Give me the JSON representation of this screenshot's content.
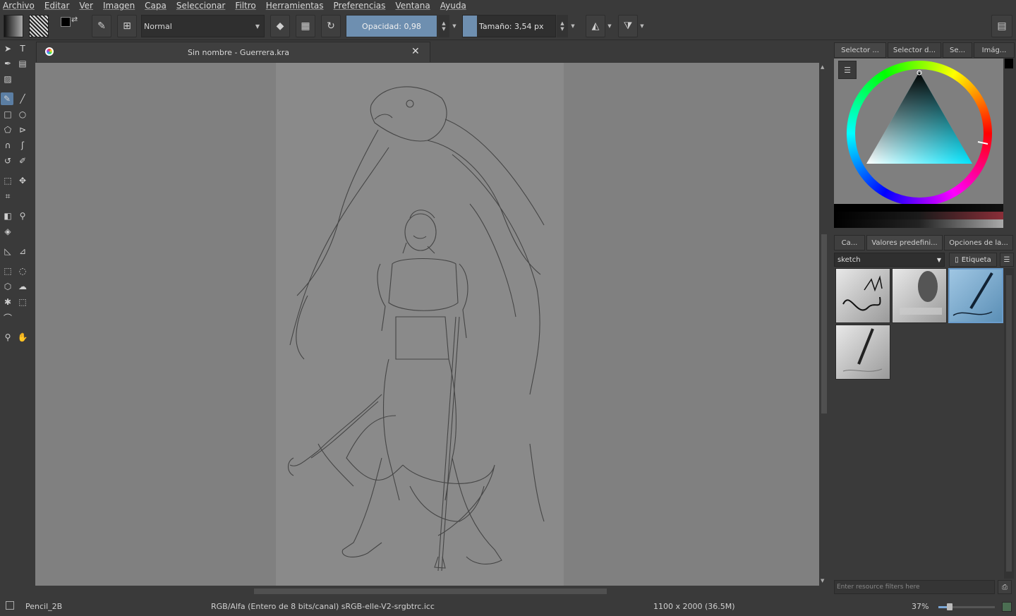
{
  "menu": [
    "Archivo",
    "Editar",
    "Ver",
    "Imagen",
    "Capa",
    "Seleccionar",
    "Filtro",
    "Herramientas",
    "Preferencias",
    "Ventana",
    "Ayuda"
  ],
  "toolbar": {
    "blend_mode": "Normal",
    "opacity_label": "Opacidad:  0,98",
    "opacity_value": 0.98,
    "size_label": "Tamaño:  3,54 px"
  },
  "document": {
    "tab_title": "Sin nombre - Guerrera.kra"
  },
  "docker": {
    "top_tabs": [
      "Selector ...",
      "Selector d...",
      "Se...",
      "Imág..."
    ],
    "preset_tabs": [
      "Ca...",
      "Valores predefini...",
      "Opciones de la..."
    ],
    "preset_filter": "sketch",
    "tag_label": "Etiqueta",
    "resource_filter_placeholder": "Enter resource filters here"
  },
  "status": {
    "brush": "Pencil_2B",
    "color_profile": "RGB/Alfa (Entero de 8 bits/canal)  sRGB-elle-V2-srgbtrc.icc",
    "dimensions": "1100 x 2000 (36.5M)",
    "zoom": "37%"
  },
  "icons": {
    "tools": [
      "select-shapes-icon",
      "text-icon",
      "calligraphy-icon",
      "edit-shapes-icon",
      "pattern-icon",
      "brush-icon",
      "line-icon",
      "rectangle-icon",
      "ellipse-icon",
      "polygon-icon",
      "polyline-icon",
      "bezier-icon",
      "freehand-path-icon",
      "dynamic-brush-icon",
      "multibrush-icon",
      "transform-icon",
      "move-icon",
      "crop-icon",
      "gradient-icon",
      "color-picker-icon",
      "fill-icon",
      "assistant-icon",
      "measure-icon",
      "rect-select-icon",
      "ellipse-select-icon",
      "polygon-select-icon",
      "freehand-select-icon",
      "magic-wand-icon",
      "similar-select-icon",
      "bezier-select-icon",
      "zoom-icon",
      "pan-icon"
    ]
  },
  "colors": {
    "accent": "#6e8fb0",
    "canvas_bg": "#808080",
    "paper": "#8a8a8a",
    "ui_bg": "#3a3a3a"
  }
}
